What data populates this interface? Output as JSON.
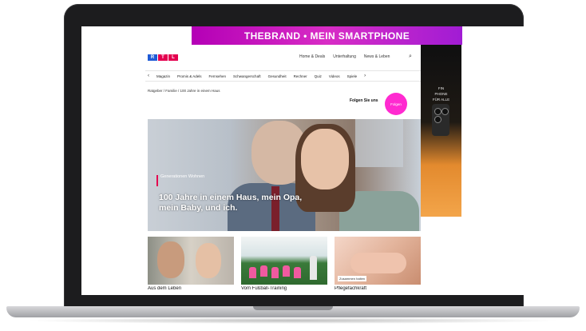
{
  "ad_banner": {
    "text": "THEBRAND • MEIN SMARTPHONE"
  },
  "ad_right": {
    "lines": [
      "FIN",
      "PHONE",
      "FÜR ALLE"
    ]
  },
  "site": {
    "logo": [
      "R",
      "T",
      "L"
    ],
    "logo_colors": [
      "#1f5bd6",
      "#e4004f",
      "#e4004f"
    ],
    "top_links": [
      "Home & Deals",
      "Unterhaltung",
      "News & Leben"
    ],
    "nav": [
      "Magazin",
      "Promis & Adels",
      "Fernsehen",
      "Schwangerschaft",
      "Gesundheit",
      "Rechner",
      "Quiz",
      "Videos",
      "Spiele"
    ],
    "breadcrumb": "Ratgeber / Familie / 100 Jahre in einem Haus",
    "follow_label": "Folgen Sie uns",
    "follow_button": "Folgen",
    "hero": {
      "kicker": "Generationen Wohnen",
      "headline": "100 Jahre in einem Haus, mein Opa, mein Baby, und ich."
    },
    "cards": [
      {
        "caption": "Aus dem Leben"
      },
      {
        "caption": "Vom Fußball-Training"
      },
      {
        "caption": "Pflegefachkraft",
        "label": "Zusammen halten"
      }
    ]
  }
}
